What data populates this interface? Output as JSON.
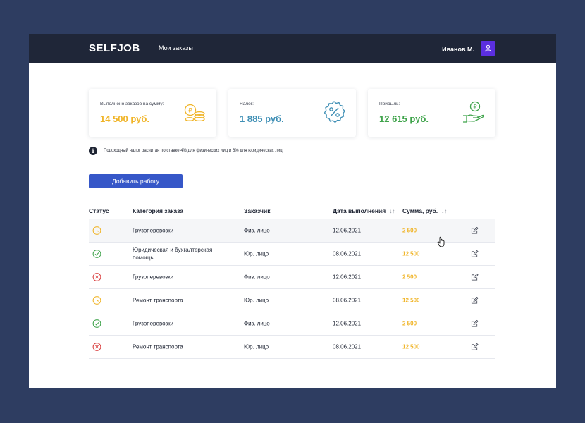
{
  "header": {
    "logo": "SELFJOB",
    "nav_link": "Мои заказы",
    "user_name": "Иванов М."
  },
  "cards": [
    {
      "label": "Выполнено заказов на сумму:",
      "value": "14 500 руб.",
      "color": "#f0b427",
      "icon": "coins-icon"
    },
    {
      "label": "Налог:",
      "value": "1 885 руб.",
      "color": "#3f8fb5",
      "icon": "percent-icon"
    },
    {
      "label": "Прибыль:",
      "value": "12 615 руб.",
      "color": "#3ea34a",
      "icon": "hand-coin-icon"
    }
  ],
  "info_text": "Подоходный налог расчитан по ставке 4% для физических лиц и 6% для юридических лиц.",
  "add_button": "Добавить работу",
  "table": {
    "headers": {
      "status": "Статус",
      "category": "Категория заказа",
      "client": "Заказчик",
      "date": "Дата выполнения",
      "sum": "Сумма, руб."
    },
    "rows": [
      {
        "status": "pending",
        "category": "Грузоперевозки",
        "client": "Физ. лицо",
        "date": "12.06.2021",
        "sum": "2 500"
      },
      {
        "status": "done",
        "category": "Юридическая и бухгалтерская помощь",
        "client": "Юр. лицо",
        "date": "08.06.2021",
        "sum": "12 500"
      },
      {
        "status": "cancelled",
        "category": "Грузоперевозки",
        "client": "Физ. лицо",
        "date": "12.06.2021",
        "sum": "2 500"
      },
      {
        "status": "pending",
        "category": "Ремонт транспорта",
        "client": "Юр. лицо",
        "date": "08.06.2021",
        "sum": "12 500"
      },
      {
        "status": "done",
        "category": "Грузоперевозки",
        "client": "Физ. лицо",
        "date": "12.06.2021",
        "sum": "2 500"
      },
      {
        "status": "cancelled",
        "category": "Ремонт транспорта",
        "client": "Юр. лицо",
        "date": "08.06.2021",
        "sum": "12 500"
      }
    ]
  },
  "colors": {
    "pending": "#f0b427",
    "done": "#3ea34a",
    "cancelled": "#d93a3a",
    "accent": "#3657c8",
    "header_bg": "#1f2638",
    "avatar_bg": "#5b2fe0"
  }
}
